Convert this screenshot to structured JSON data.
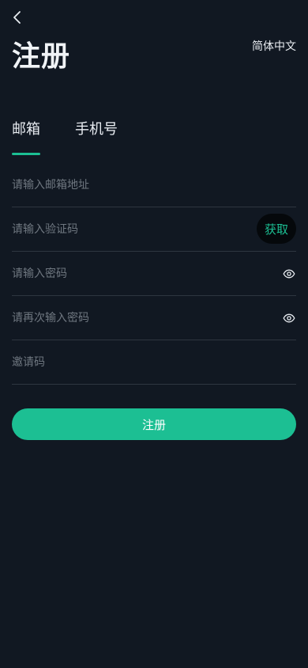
{
  "header": {
    "back_icon": "chevron-left-icon",
    "title": "注册",
    "language": "简体中文"
  },
  "tabs": [
    {
      "label": "邮箱",
      "active": true
    },
    {
      "label": "手机号",
      "active": false
    }
  ],
  "form": {
    "email_placeholder": "请输入邮箱地址",
    "code_placeholder": "请输入验证码",
    "get_code_label": "获取",
    "password_placeholder": "请输入密码",
    "confirm_password_placeholder": "请再次输入密码",
    "invite_placeholder": "邀请码",
    "eye_icon": "eye-icon"
  },
  "submit_label": "注册",
  "colors": {
    "background": "#111822",
    "accent": "#1cbf93",
    "divider": "#2e3640",
    "placeholder": "#6f7780"
  }
}
